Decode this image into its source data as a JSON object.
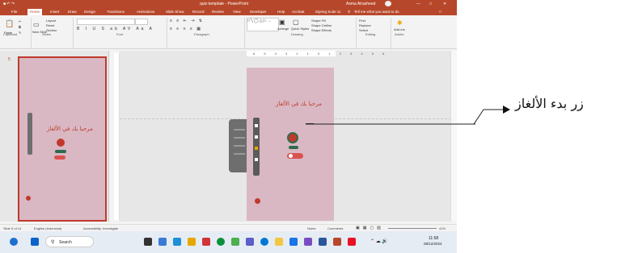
{
  "window": {
    "title": "quiz-template - PowerPoint",
    "user": "Asma Alrasheed",
    "autosave": "AutoSave"
  },
  "tabs": [
    "File",
    "Home",
    "Insert",
    "Draw",
    "Design",
    "Transitions",
    "Animations",
    "Slide Show",
    "Record",
    "Review",
    "View",
    "Developer",
    "Help",
    "Acrobat",
    "iSpring Suite 11"
  ],
  "search": {
    "placeholder": "Tell me what you want to do"
  },
  "ribbon": {
    "groups": [
      "Clipboard",
      "Slides",
      "Font",
      "Paragraph",
      "Drawing",
      "Editing",
      "Adobe"
    ],
    "paste": "Paste",
    "new_slide": "New Slide",
    "layout": "Layout",
    "reset": "Reset",
    "section": "Section",
    "arrange": "Arrange",
    "quick_styles": "Quick Styles",
    "shape_fill": "Shape Fill",
    "shape_outline": "Shape Outline",
    "shape_effects": "Shape Effects",
    "find": "Find",
    "replace": "Replace",
    "select": "Select",
    "addins": "Add-ins"
  },
  "slide_thumb": {
    "number": "5"
  },
  "slide": {
    "heading": "مرحبا بك في الألغاز"
  },
  "status": {
    "slide": "Slide 5 of 14",
    "language": "English (Indonesia)",
    "accessibility": "Accessibility: Investigate",
    "notes": "Notes",
    "comments": "Comments",
    "zoom": "41%"
  },
  "taskbar": {
    "search": "Search",
    "time": "11:58",
    "date": "08/12/2024"
  },
  "annotation": {
    "text": "زر بدء الألغاز"
  },
  "colors": {
    "accent": "#b7472a",
    "slide_bg": "#d9b8c3",
    "heading": "#c0392b",
    "button": "#d9534f"
  }
}
